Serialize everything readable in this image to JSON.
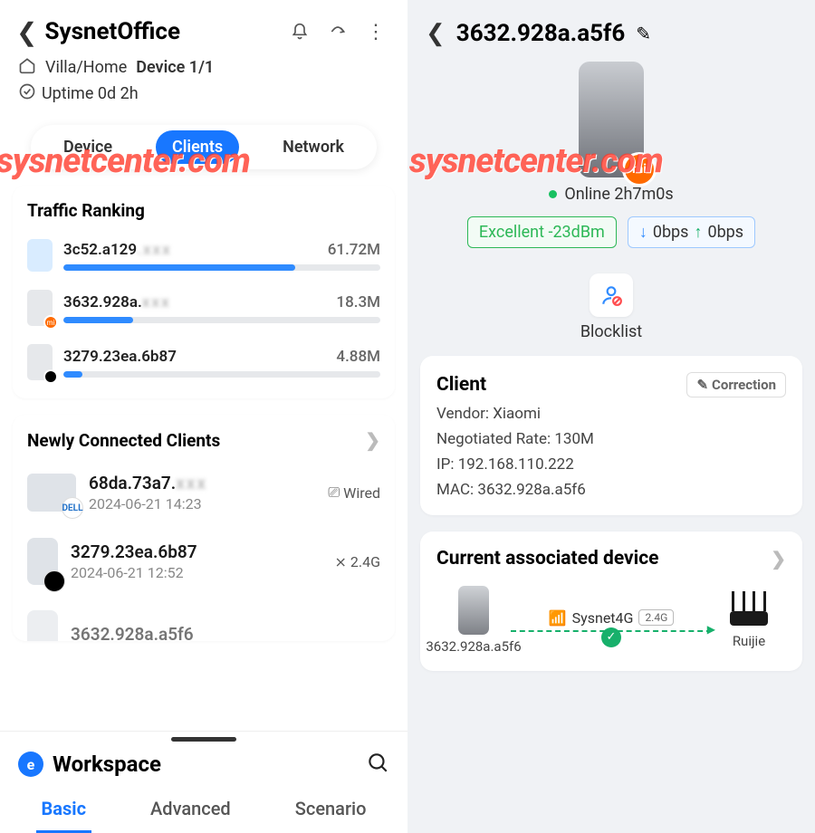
{
  "left": {
    "site_name": "SysnetOffice",
    "location": "Villa/Home",
    "device_count": "Device 1/1",
    "uptime": "Uptime 0d 2h",
    "tabs": {
      "device": "Device",
      "clients": "Clients",
      "network": "Network"
    },
    "traffic": {
      "title": "Traffic Ranking",
      "items": [
        {
          "name": "3c52.a129",
          "usage": "61.72M",
          "pct": 73
        },
        {
          "name": "3632.928a.",
          "usage": "18.3M",
          "pct": 22
        },
        {
          "name": "3279.23ea.6b87",
          "usage": "4.88M",
          "pct": 6
        }
      ]
    },
    "newly": {
      "title": "Newly Connected Clients",
      "items": [
        {
          "name": "68da.73a7.",
          "time": "2024-06-21 14:23",
          "conn": "Wired",
          "brand": "DELL"
        },
        {
          "name": "3279.23ea.6b87",
          "time": "2024-06-21 12:52",
          "conn": "2.4G",
          "brand": "apple"
        },
        {
          "name": "3632.928a.a5f6",
          "time": "",
          "conn": "",
          "brand": ""
        }
      ]
    },
    "workspace": {
      "title": "Workspace",
      "tabs": {
        "basic": "Basic",
        "advanced": "Advanced",
        "scenario": "Scenario"
      }
    }
  },
  "right": {
    "title": "3632.928a.a5f6",
    "online_label": "Online 2h7m0s",
    "signal": "Excellent -23dBm",
    "rate_down": "0bps",
    "rate_up": "0bps",
    "blocklist_label": "Blocklist",
    "client": {
      "title": "Client",
      "correction": "Correction",
      "vendor_label": "Vendor: ",
      "vendor": "Xiaomi",
      "rate_label": "Negotiated Rate: ",
      "rate": "130M",
      "ip_label": "IP: ",
      "ip": "192.168.110.222",
      "mac_label": "MAC: ",
      "mac": "3632.928a.a5f6"
    },
    "assoc": {
      "title": "Current associated device",
      "client_name": "3632.928a.a5f6",
      "ssid": "Sysnet4G",
      "band": "2.4G",
      "ap_name": "Ruijie"
    }
  },
  "watermark": "sysnetcenter.com"
}
